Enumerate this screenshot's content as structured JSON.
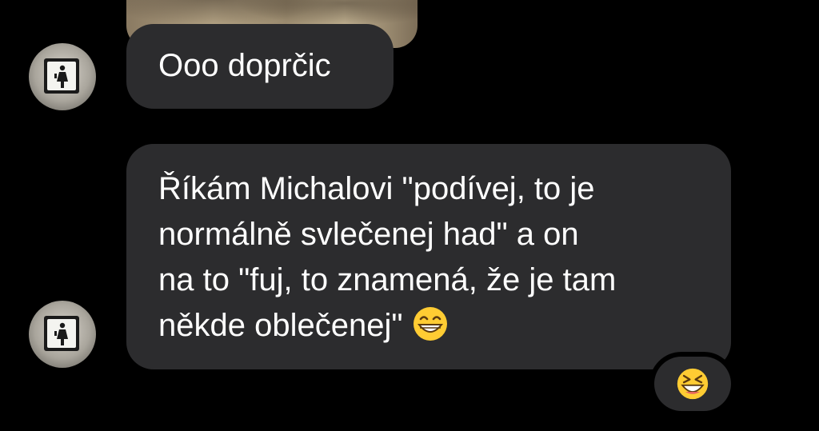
{
  "chat": {
    "messages": [
      {
        "text": "Ooo doprčic"
      },
      {
        "text": "Říkám Michalovi \"podívej, to je\nnormálně svlečenej had\" a on\nna to \"fuj, to znamená, že je tam\nněkde oblečenej\" ",
        "emoji": "grinning-face-with-smiling-eyes-icon"
      }
    ],
    "reaction": {
      "emoji": "grinning-squinting-face-icon"
    }
  },
  "colors": {
    "background": "#000000",
    "bubble": "#2c2c2e",
    "text": "#ffffff",
    "emoji_face": "#ffcc33"
  }
}
